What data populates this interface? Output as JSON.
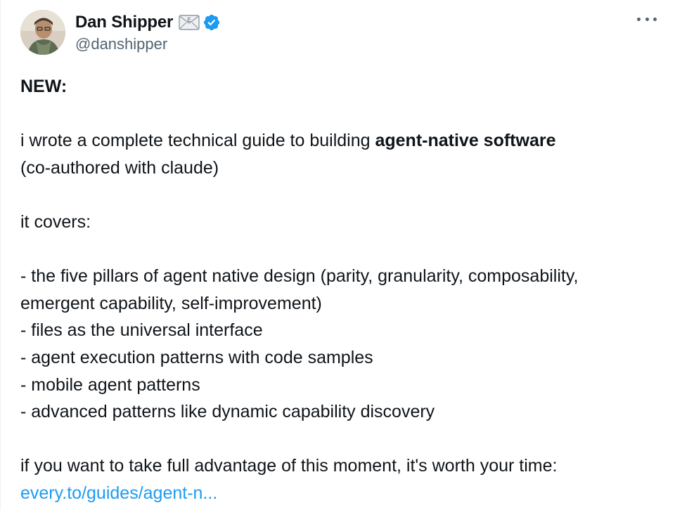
{
  "author": {
    "name": "Dan Shipper",
    "handle": "@danshipper",
    "mail_badge_letter": "E",
    "icons": [
      "envelope-emoji-icon",
      "verified-badge-icon"
    ]
  },
  "menu": {
    "more_label": "More"
  },
  "tweet": {
    "headline": "NEW:",
    "intro_prefix": "i wrote a complete technical guide to building ",
    "intro_bold": "agent-native software",
    "intro_suffix": "(co-authored with claude)",
    "covers_label": "it covers:",
    "bullets": [
      "- the five pillars of agent native design (parity, granularity, composability,",
      "emergent capability, self-improvement)",
      "- files as the universal interface",
      "- agent execution patterns with code samples",
      "- mobile agent patterns",
      "- advanced patterns like dynamic capability discovery"
    ],
    "closing": "if you want to take full advantage of this moment, it's worth your time:",
    "link_text": "every.to/guides/agent-n..."
  },
  "colors": {
    "text": "#0f1419",
    "secondary": "#536471",
    "link": "#1d9bf0",
    "verified": "#1d9bf0"
  }
}
